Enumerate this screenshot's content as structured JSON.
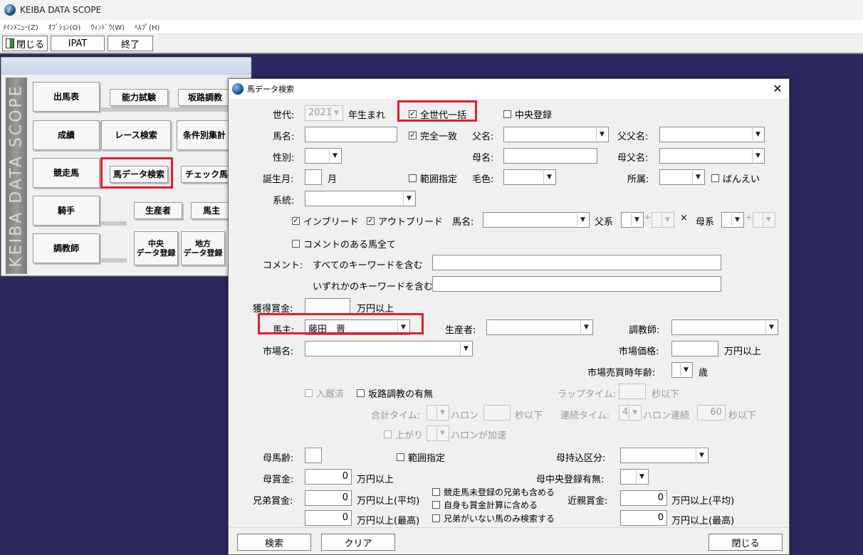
{
  "app": {
    "title": "KEIBA DATA SCOPE"
  },
  "menubar": [
    "ﾒｲﾝﾒﾆｭｰ(Z)",
    "ｵﾌﾟｼｮﾝ(O)",
    "ｳｨﾝﾄﾞｳ(W)",
    "ﾍﾙﾌﾟ(H)"
  ],
  "toolbar": {
    "close": "閉じる",
    "ipat": "IPAT",
    "end": "終了"
  },
  "start_menu": {
    "title": "ｽﾀｰﾄﾒﾆｭｰ",
    "banner": "KEIBA DATA SCOPE",
    "big_buttons": [
      "出馬表",
      "成績",
      "競走馬",
      "騎手",
      "調教師"
    ],
    "row1": [
      "能力試験",
      "坂路調教"
    ],
    "row2": [
      "レース検索",
      "条件別集計"
    ],
    "row3": [
      "馬データ検索",
      "チェック馬"
    ],
    "row4": [
      "生産者",
      "馬主"
    ],
    "row5": [
      "中央\nデータ登録",
      "地方\nデータ登録"
    ]
  },
  "dialog": {
    "title": "馬データ検索",
    "generation_label": "世代:",
    "generation_value": "2021",
    "born_label": "年生まれ",
    "all_generations": "全世代一括",
    "central_reg": "中央登録",
    "horse_name": "馬名:",
    "exact_match": "完全一致",
    "sire_name": "父名:",
    "grandsire_name": "父父名:",
    "sex": "性別:",
    "dam_name": "母名:",
    "dam_sire_name": "母父名:",
    "birth_month": "誕生月:",
    "month": "月",
    "range": "範囲指定",
    "coat": "毛色:",
    "affiliation": "所属:",
    "banei": "ばんえい",
    "lineage": "系統:",
    "inbreed": "インブリード",
    "outbreed": "アウトブリード",
    "breed_horse_name": "馬名:",
    "sire_line": "父系",
    "plus": "+",
    "times": "×",
    "dam_line": "母系",
    "commented_all": "コメントのある馬全て",
    "comment_label": "コメント:",
    "all_keywords": "すべてのキーワードを含む",
    "any_keywords": "いずれかのキーワードを含む",
    "prize": "獲得賞金:",
    "man_yen_over": "万円以上",
    "owner": "馬主:",
    "owner_value": "藤田　晋",
    "breeder": "生産者:",
    "trainer": "調教師:",
    "market": "市場名:",
    "market_price": "市場価格:",
    "market_age": "市場売買時年齢:",
    "age_unit": "歳",
    "admitted": "入厩済",
    "slope_training": "坂路調教の有無",
    "lap_time": "ラップタイム:",
    "sec_under": "秒以下",
    "total_time": "合計タイム:",
    "furlong": "ハロン",
    "consec_time": "連続タイム:",
    "consec_value": "4",
    "furlong_consec": "ハロン連続",
    "consec_sec": "60",
    "rising": "上がり",
    "furlong_accel": "ハロンが加速",
    "dam_age": "母馬齢:",
    "dam_range": "範囲指定",
    "dam_import": "母持込区分:",
    "dam_prize": "母賞金:",
    "zero": "0",
    "dam_central_reg": "母中央登録有無:",
    "sibling_prize": "兄弟賞金:",
    "avg_over": "万円以上(平均)",
    "max_over": "万円以上(最高)",
    "include_unreg_siblings": "競走馬未登録の兄弟も含める",
    "include_self": "自身も賞金計算に含める",
    "only_no_siblings": "兄弟がいない馬のみ検索する",
    "relative_prize": "近親賞金:",
    "search_btn": "検索",
    "clear_btn": "クリア",
    "close_btn": "閉じる"
  },
  "colors": {
    "desktop": "#2a285e",
    "highlight": "#e41d2b"
  }
}
